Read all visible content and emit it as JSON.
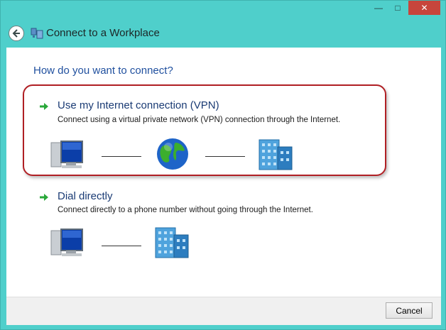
{
  "window": {
    "title": "Connect to a Workplace",
    "caption": {
      "minimize": "—",
      "maximize": "□",
      "close": "✕"
    }
  },
  "main": {
    "question": "How do you want to connect?",
    "options": [
      {
        "title": "Use my Internet connection (VPN)",
        "description": "Connect using a virtual private network (VPN) connection through the Internet.",
        "diagram": [
          "computer-icon",
          "globe-icon",
          "building-icon"
        ]
      },
      {
        "title": "Dial directly",
        "description": "Connect directly to a phone number without going through the Internet.",
        "diagram": [
          "computer-icon",
          "building-icon"
        ]
      }
    ]
  },
  "footer": {
    "cancel_label": "Cancel"
  },
  "colors": {
    "frame": "#4fcfcb",
    "heading": "#1f4f9e",
    "highlight": "#b01f24",
    "close": "#c7453c"
  }
}
